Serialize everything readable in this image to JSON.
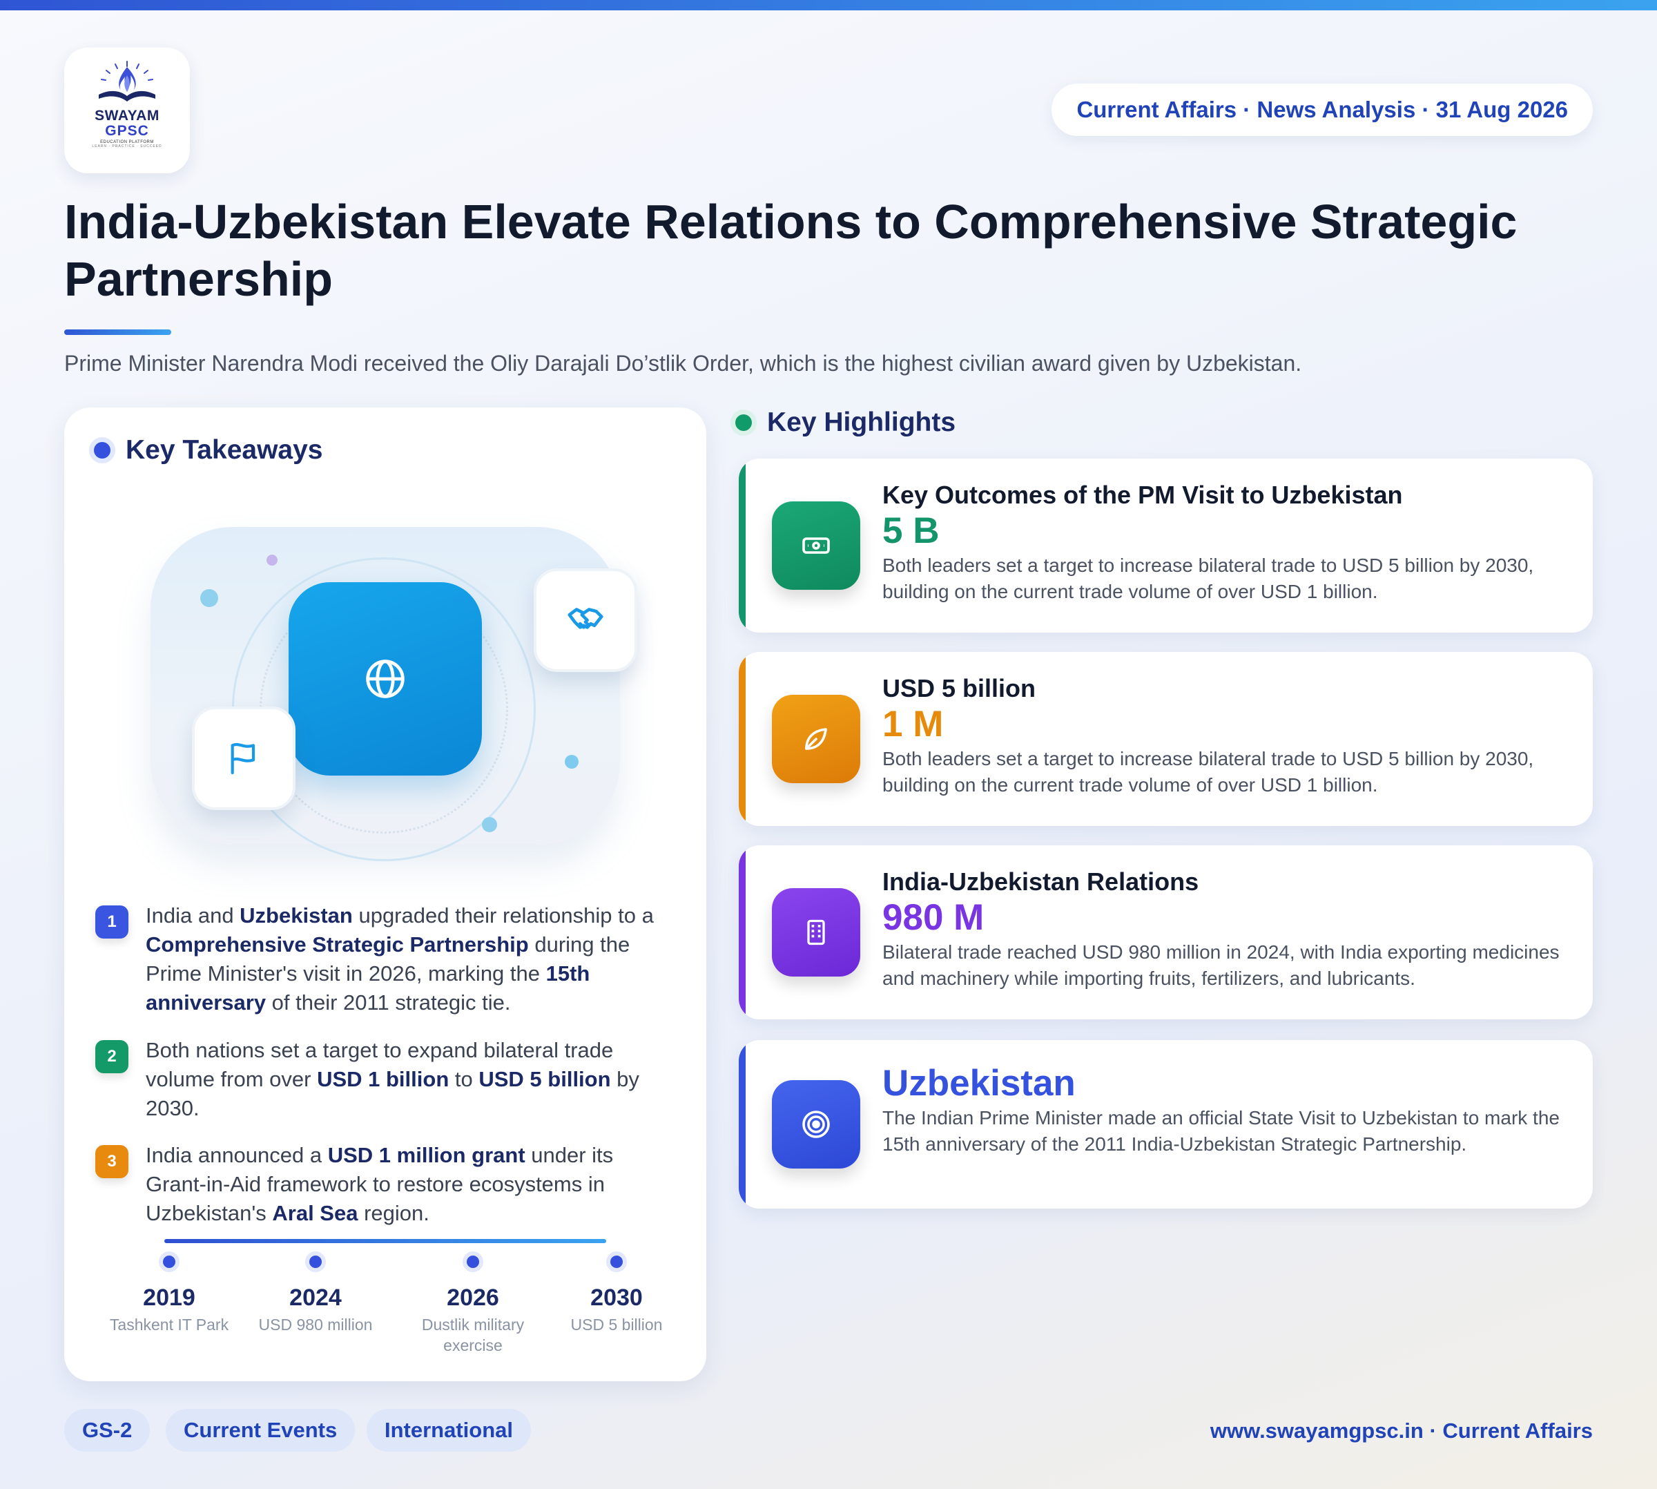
{
  "header": {
    "logo": {
      "line1": "SWAYAM",
      "line2": "GPSC",
      "line3": "EDUCATION PLATFORM",
      "line4": "LEARN · PRACTICE · SUCCEED"
    },
    "pill": "Current Affairs · News Analysis · 31 Aug 2026",
    "title": "India-Uzbekistan Elevate Relations to Comprehensive Strategic Partnership",
    "subtitle": "Prime Minister Narendra Modi received the Oliy Darajali Do’stlik Order, which is the highest civilian award given by Uzbekistan."
  },
  "left": {
    "title": "Key Takeaways",
    "takeaways": [
      {
        "num": "1",
        "color": "#3a56e0",
        "parts": [
          "India and ",
          "Uzbekistan",
          " upgraded their relationship to a ",
          "Comprehensive Strategic Partnership",
          " during the Prime Minister's visit in 2026, marking the ",
          "15th anniversary",
          " of their 2011 strategic tie."
        ]
      },
      {
        "num": "2",
        "color": "#139a68",
        "parts": [
          "Both nations set a target to expand bilateral trade volume from over ",
          "USD 1 billion",
          " to ",
          "USD 5 billion",
          " by 2030."
        ]
      },
      {
        "num": "3",
        "color": "#e78a0d",
        "parts": [
          "India announced a ",
          "USD 1 million grant",
          " under its Grant-in-Aid framework to restore ecosystems in Uzbekistan's ",
          "Aral Sea",
          " region."
        ]
      }
    ],
    "timeline": [
      {
        "year": "2019",
        "label": "Tashkent IT Park"
      },
      {
        "year": "2024",
        "label": "USD 980 million"
      },
      {
        "year": "2026",
        "label": "Dustlik military exercise"
      },
      {
        "year": "2030",
        "label": "USD 5 billion"
      }
    ]
  },
  "right": {
    "title": "Key Highlights",
    "cards": [
      {
        "icon": "cash-icon",
        "accent": "#13946a",
        "heading": "Key Outcomes of the PM Visit to Uzbekistan",
        "value": "5 B",
        "desc": "Both leaders set a target to increase bilateral trade to USD 5 billion by 2030, building on the current trade volume of over USD 1 billion."
      },
      {
        "icon": "leaf-icon",
        "accent": "#e68a0c",
        "heading": "USD 5 billion",
        "value": "1 M",
        "desc": "Both leaders set a target to increase bilateral trade to USD 5 billion by 2030, building on the current trade volume of over USD 1 billion."
      },
      {
        "icon": "building-icon",
        "accent": "#7a35e2",
        "heading": "India-Uzbekistan Relations",
        "value": "980 M",
        "desc": "Bilateral trade reached USD 980 million in 2024, with India exporting medicines and machinery while importing fruits, fertilizers, and lubricants."
      },
      {
        "icon": "target-icon",
        "accent": "#3552df",
        "heading": "",
        "value": "Uzbekistan",
        "desc": "The Indian Prime Minister made an official State Visit to Uzbekistan to mark the 15th anniversary of the 2011 India-Uzbekistan Strategic Partnership."
      }
    ]
  },
  "footer": {
    "tags": [
      "GS-2",
      "Current Events",
      "International"
    ],
    "right": "www.swayamgpsc.in · Current Affairs"
  }
}
